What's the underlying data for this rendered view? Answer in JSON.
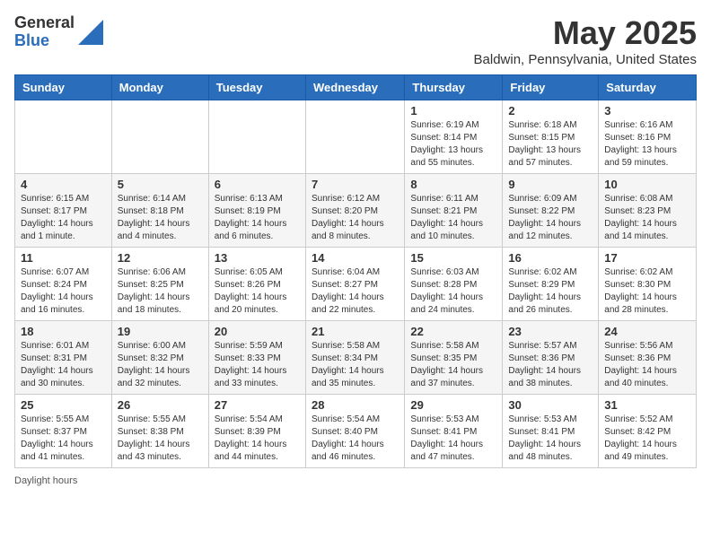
{
  "logo": {
    "general": "General",
    "blue": "Blue"
  },
  "header": {
    "month_year": "May 2025",
    "location": "Baldwin, Pennsylvania, United States"
  },
  "days_of_week": [
    "Sunday",
    "Monday",
    "Tuesday",
    "Wednesday",
    "Thursday",
    "Friday",
    "Saturday"
  ],
  "weeks": [
    [
      {
        "day": "",
        "info": ""
      },
      {
        "day": "",
        "info": ""
      },
      {
        "day": "",
        "info": ""
      },
      {
        "day": "",
        "info": ""
      },
      {
        "day": "1",
        "info": "Sunrise: 6:19 AM\nSunset: 8:14 PM\nDaylight: 13 hours and 55 minutes."
      },
      {
        "day": "2",
        "info": "Sunrise: 6:18 AM\nSunset: 8:15 PM\nDaylight: 13 hours and 57 minutes."
      },
      {
        "day": "3",
        "info": "Sunrise: 6:16 AM\nSunset: 8:16 PM\nDaylight: 13 hours and 59 minutes."
      }
    ],
    [
      {
        "day": "4",
        "info": "Sunrise: 6:15 AM\nSunset: 8:17 PM\nDaylight: 14 hours and 1 minute."
      },
      {
        "day": "5",
        "info": "Sunrise: 6:14 AM\nSunset: 8:18 PM\nDaylight: 14 hours and 4 minutes."
      },
      {
        "day": "6",
        "info": "Sunrise: 6:13 AM\nSunset: 8:19 PM\nDaylight: 14 hours and 6 minutes."
      },
      {
        "day": "7",
        "info": "Sunrise: 6:12 AM\nSunset: 8:20 PM\nDaylight: 14 hours and 8 minutes."
      },
      {
        "day": "8",
        "info": "Sunrise: 6:11 AM\nSunset: 8:21 PM\nDaylight: 14 hours and 10 minutes."
      },
      {
        "day": "9",
        "info": "Sunrise: 6:09 AM\nSunset: 8:22 PM\nDaylight: 14 hours and 12 minutes."
      },
      {
        "day": "10",
        "info": "Sunrise: 6:08 AM\nSunset: 8:23 PM\nDaylight: 14 hours and 14 minutes."
      }
    ],
    [
      {
        "day": "11",
        "info": "Sunrise: 6:07 AM\nSunset: 8:24 PM\nDaylight: 14 hours and 16 minutes."
      },
      {
        "day": "12",
        "info": "Sunrise: 6:06 AM\nSunset: 8:25 PM\nDaylight: 14 hours and 18 minutes."
      },
      {
        "day": "13",
        "info": "Sunrise: 6:05 AM\nSunset: 8:26 PM\nDaylight: 14 hours and 20 minutes."
      },
      {
        "day": "14",
        "info": "Sunrise: 6:04 AM\nSunset: 8:27 PM\nDaylight: 14 hours and 22 minutes."
      },
      {
        "day": "15",
        "info": "Sunrise: 6:03 AM\nSunset: 8:28 PM\nDaylight: 14 hours and 24 minutes."
      },
      {
        "day": "16",
        "info": "Sunrise: 6:02 AM\nSunset: 8:29 PM\nDaylight: 14 hours and 26 minutes."
      },
      {
        "day": "17",
        "info": "Sunrise: 6:02 AM\nSunset: 8:30 PM\nDaylight: 14 hours and 28 minutes."
      }
    ],
    [
      {
        "day": "18",
        "info": "Sunrise: 6:01 AM\nSunset: 8:31 PM\nDaylight: 14 hours and 30 minutes."
      },
      {
        "day": "19",
        "info": "Sunrise: 6:00 AM\nSunset: 8:32 PM\nDaylight: 14 hours and 32 minutes."
      },
      {
        "day": "20",
        "info": "Sunrise: 5:59 AM\nSunset: 8:33 PM\nDaylight: 14 hours and 33 minutes."
      },
      {
        "day": "21",
        "info": "Sunrise: 5:58 AM\nSunset: 8:34 PM\nDaylight: 14 hours and 35 minutes."
      },
      {
        "day": "22",
        "info": "Sunrise: 5:58 AM\nSunset: 8:35 PM\nDaylight: 14 hours and 37 minutes."
      },
      {
        "day": "23",
        "info": "Sunrise: 5:57 AM\nSunset: 8:36 PM\nDaylight: 14 hours and 38 minutes."
      },
      {
        "day": "24",
        "info": "Sunrise: 5:56 AM\nSunset: 8:36 PM\nDaylight: 14 hours and 40 minutes."
      }
    ],
    [
      {
        "day": "25",
        "info": "Sunrise: 5:55 AM\nSunset: 8:37 PM\nDaylight: 14 hours and 41 minutes."
      },
      {
        "day": "26",
        "info": "Sunrise: 5:55 AM\nSunset: 8:38 PM\nDaylight: 14 hours and 43 minutes."
      },
      {
        "day": "27",
        "info": "Sunrise: 5:54 AM\nSunset: 8:39 PM\nDaylight: 14 hours and 44 minutes."
      },
      {
        "day": "28",
        "info": "Sunrise: 5:54 AM\nSunset: 8:40 PM\nDaylight: 14 hours and 46 minutes."
      },
      {
        "day": "29",
        "info": "Sunrise: 5:53 AM\nSunset: 8:41 PM\nDaylight: 14 hours and 47 minutes."
      },
      {
        "day": "30",
        "info": "Sunrise: 5:53 AM\nSunset: 8:41 PM\nDaylight: 14 hours and 48 minutes."
      },
      {
        "day": "31",
        "info": "Sunrise: 5:52 AM\nSunset: 8:42 PM\nDaylight: 14 hours and 49 minutes."
      }
    ]
  ],
  "footer": {
    "daylight_label": "Daylight hours"
  }
}
